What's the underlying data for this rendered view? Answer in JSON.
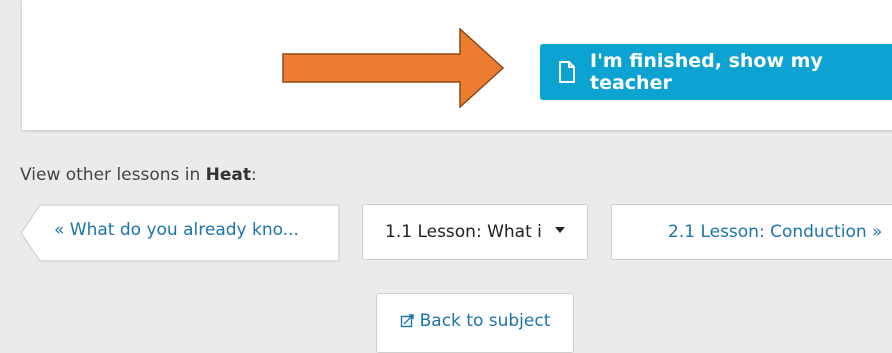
{
  "finish_button": {
    "label": "I'm finished, show my teacher",
    "icon": "document-icon",
    "color": "#0ca3d2"
  },
  "annotation": {
    "icon": "orange-arrow-icon",
    "color": "#ef7d31"
  },
  "other_lessons": {
    "prefix": "View other lessons in ",
    "subject": "Heat",
    "suffix": ":"
  },
  "nav": {
    "previous_label": "« What do you already kno...",
    "current_select": "1.1 Lesson: What i",
    "next_label": "2.1 Lesson: Conduction  »"
  },
  "back_button": {
    "label": "Back to subject",
    "icon": "back-subject-icon"
  },
  "link_color": "#1b75a8"
}
